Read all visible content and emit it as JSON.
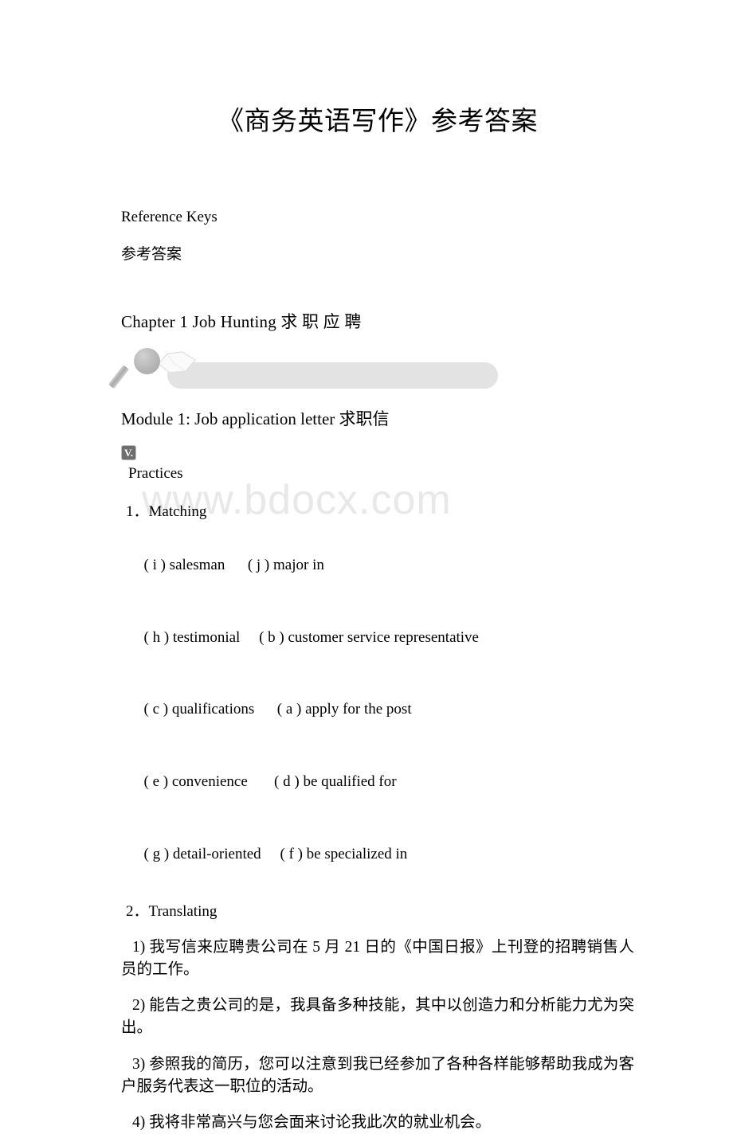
{
  "document": {
    "title": "《商务英语写作》参考答案",
    "watermark": "www.bdocx.com"
  },
  "reference": {
    "en": "Reference Keys",
    "cn": "参考答案"
  },
  "chapter": {
    "heading": "Chapter 1 Job Hunting 求 职 应 聘",
    "banner_icons": {
      "magnifier": "magnifier-icon",
      "book": "book-icon",
      "bar": "banner-bar"
    }
  },
  "module": {
    "heading": "Module 1: Job application letter 求职信",
    "image_placeholder_label": "V.",
    "practices_label": " Practices"
  },
  "matching": {
    "heading": "1．Matching",
    "rows": [
      {
        "left": "( i ) salesman",
        "right": "( j ) major in",
        "gap": "      "
      },
      {
        "left": "( h ) testimonial",
        "right": "( b ) customer service representative",
        "gap": "     "
      },
      {
        "left": "( c ) qualifications",
        "right": "( a ) apply for the post",
        "gap": "      "
      },
      {
        "left": "( e ) convenience",
        "right": "( d ) be qualified for",
        "gap": "       "
      },
      {
        "left": "( g ) detail-oriented",
        "right": "( f ) be specialized in",
        "gap": "     "
      }
    ]
  },
  "translating": {
    "heading": "2．Translating",
    "items": [
      "1) 我写信来应聘贵公司在 5 月 21 日的《中国日报》上刊登的招聘销售人员的工作。",
      "2) 能告之贵公司的是，我具备多种技能，其中以创造力和分析能力尤为突出。",
      "3) 参照我的简历，您可以注意到我已经参加了各种各样能够帮助我成为客户服务代表这一职位的活动。",
      "4) 我将非常高兴与您会面来讨论我此次的就业机会。"
    ]
  },
  "colors": {
    "text": "#000000",
    "page_background": "#ffffff",
    "watermark": "#e8e8e8",
    "banner_bar": "#e3e3e3",
    "badge_background": "#6e6e6e"
  }
}
